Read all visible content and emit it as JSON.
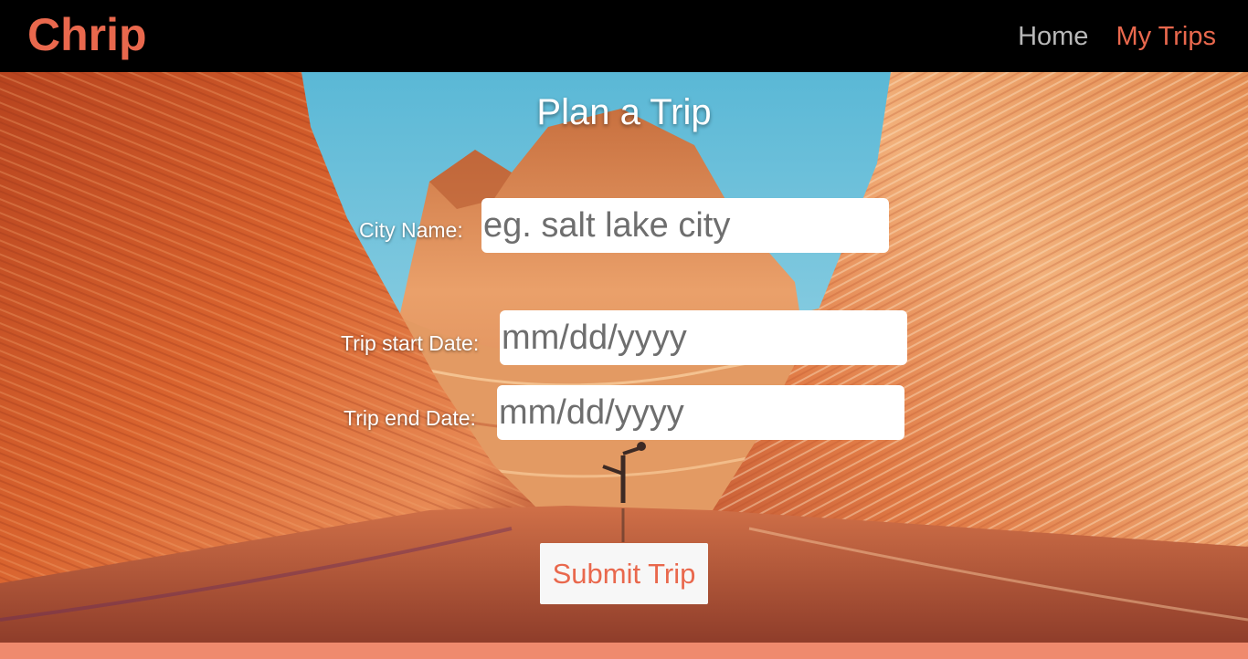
{
  "navbar": {
    "brand": "Chrip",
    "links": [
      {
        "label": "Home",
        "active": false
      },
      {
        "label": "My Trips",
        "active": true
      }
    ]
  },
  "colors": {
    "brand": "#e9684d",
    "navbar_bg": "#000000",
    "footer_bar": "#ef8a6d",
    "nav_inactive": "#b8b8b8"
  },
  "hero": {
    "image_subject": "red sandstone canyon wave formation with a person in a yoga pose reflected in water"
  },
  "form": {
    "title": "Plan a Trip",
    "city": {
      "label": "City Name:",
      "placeholder": "eg. salt lake city",
      "value": ""
    },
    "start_date": {
      "label": "Trip start Date:",
      "placeholder": "mm/dd/yyyy",
      "value": ""
    },
    "end_date": {
      "label": "Trip end Date:",
      "placeholder": "mm/dd/yyyy",
      "value": ""
    },
    "submit_label": "Submit Trip"
  }
}
